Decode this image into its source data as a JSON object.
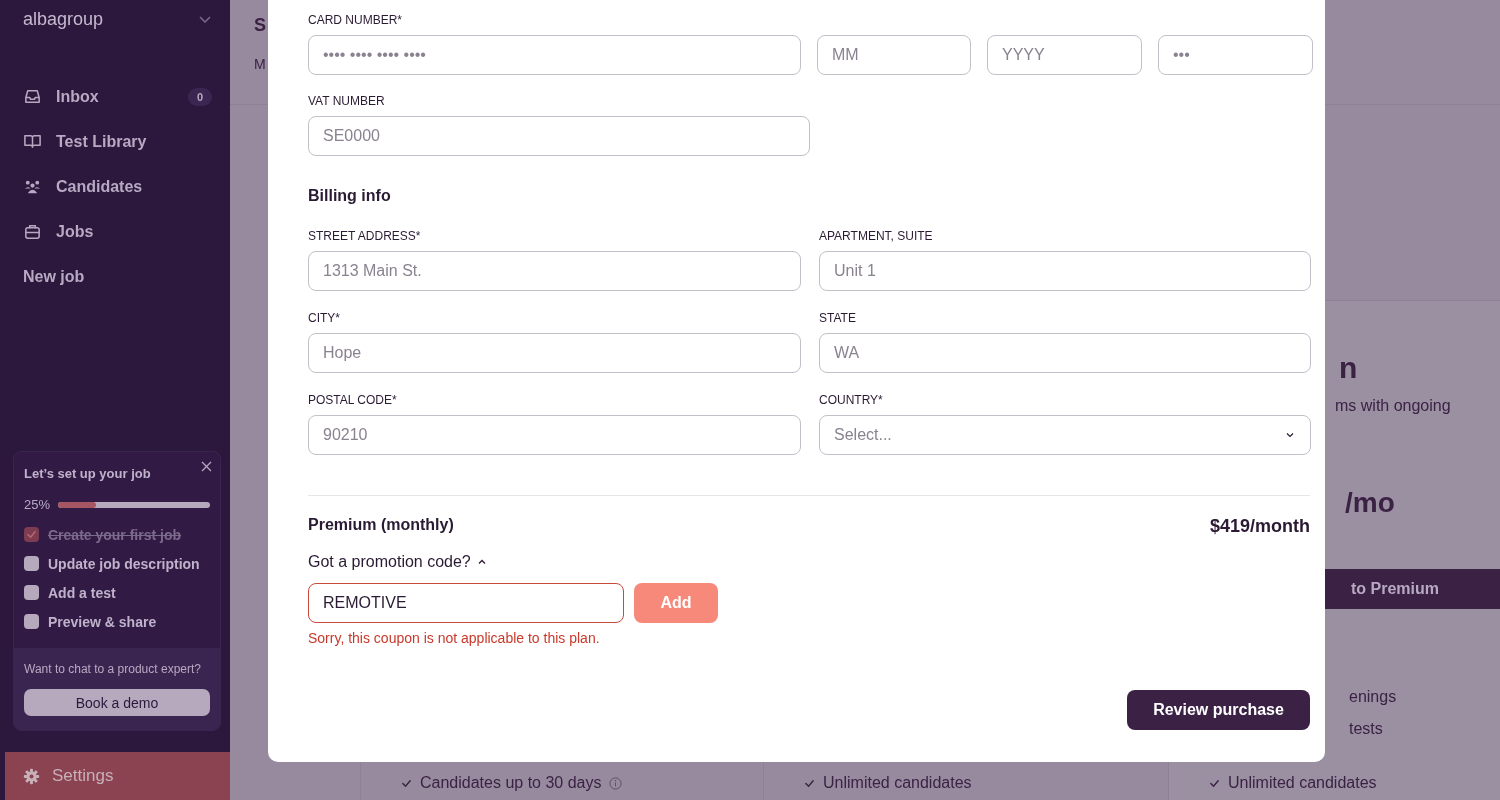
{
  "sidebar": {
    "workspace": "albagroup",
    "nav": [
      {
        "kind": "inbox",
        "label": "Inbox",
        "count": "0",
        "selected": false
      },
      {
        "kind": "book",
        "label": "Test Library",
        "selected": false
      },
      {
        "kind": "people",
        "label": "Candidates",
        "selected": false
      },
      {
        "kind": "briefcase",
        "label": "Jobs",
        "selected": false
      }
    ],
    "new_job": "New job",
    "setup": {
      "title": "Let’s set up your job",
      "percent": "25%",
      "level": 0.25,
      "tasks": [
        {
          "label": "Create your first job",
          "checked": true
        },
        {
          "label": "Update job description",
          "checked": false
        },
        {
          "label": "Add a test",
          "checked": false
        },
        {
          "label": "Preview & share",
          "checked": false
        }
      ],
      "chat_prompt": "Want to chat to a product expert?",
      "demo_button": "Book a demo"
    },
    "settings": {
      "label": "Settings",
      "selected": true
    }
  },
  "page": {
    "title": "S",
    "tab": "M",
    "plans": [
      {
        "features": [
          {
            "text": "Candidates up to 30 days",
            "info": true
          }
        ]
      },
      {
        "features": [
          {
            "text": "Unlimited candidates",
            "info": false
          }
        ]
      },
      {
        "heading": "n",
        "description": "ms with ongoing",
        "price": "/mo",
        "button": "to Premium",
        "partial_features": [
          "enings",
          "tests"
        ],
        "features": [
          {
            "text": "Unlimited candidates",
            "info": false
          }
        ]
      }
    ]
  },
  "modal": {
    "card_label": "CARD NUMBER*",
    "card_fields": [
      {
        "placeholder": "•••• •••• •••• ••••"
      },
      {
        "placeholder": "MM"
      },
      {
        "placeholder": "YYYY"
      },
      {
        "placeholder": "•••"
      }
    ],
    "vat": {
      "label": "VAT NUMBER",
      "placeholder": "SE0000"
    },
    "billing_title": "Billing info",
    "billing_fields": [
      {
        "kind": "text",
        "label": "STREET ADDRESS*",
        "placeholder": "1313 Main St."
      },
      {
        "kind": "text",
        "label": "APARTMENT, SUITE",
        "placeholder": "Unit 1"
      },
      {
        "kind": "text",
        "label": "CITY*",
        "placeholder": "Hope"
      },
      {
        "kind": "text",
        "label": "STATE",
        "placeholder": "WA"
      },
      {
        "kind": "text",
        "label": "POSTAL CODE*",
        "placeholder": "90210"
      },
      {
        "kind": "select",
        "label": "COUNTRY*",
        "placeholder": "Select..."
      }
    ],
    "plan_name": "Premium (monthly)",
    "plan_price": "$419/month",
    "promo_toggle": {
      "label": "Got a promotion code?",
      "expanded": true
    },
    "promo": {
      "value": "REMOTIVE",
      "error": true,
      "add_button": "Add",
      "disabled": true,
      "error_message": "Sorry, this coupon is not applicable to this plan."
    },
    "review_button": "Review purchase"
  }
}
